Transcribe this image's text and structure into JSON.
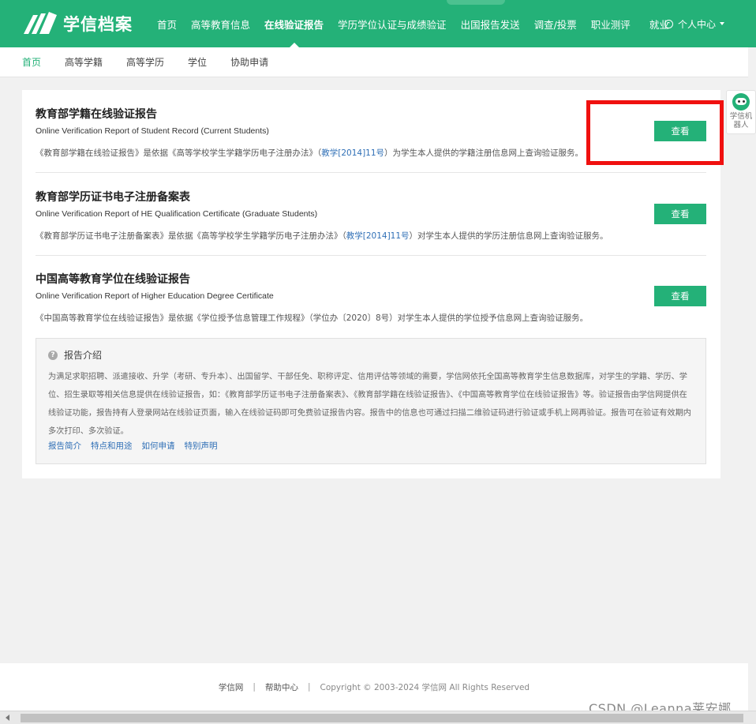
{
  "header": {
    "logo_text": "学信档案",
    "nav": [
      {
        "label": "首页",
        "active": false
      },
      {
        "label": "高等教育信息",
        "active": false
      },
      {
        "label": "在线验证报告",
        "active": true
      },
      {
        "label": "学历学位认证与成绩验证",
        "active": false
      },
      {
        "label": "出国报告发送",
        "active": false
      },
      {
        "label": "调查/投票",
        "active": false
      },
      {
        "label": "职业测评",
        "active": false
      },
      {
        "label": "就业",
        "active": false
      }
    ],
    "user_center": "个人中心"
  },
  "subnav": [
    {
      "label": "首页",
      "active": true
    },
    {
      "label": "高等学籍",
      "active": false
    },
    {
      "label": "高等学历",
      "active": false
    },
    {
      "label": "学位",
      "active": false
    },
    {
      "label": "协助申请",
      "active": false
    }
  ],
  "robot": {
    "label": "学信机器人"
  },
  "reports": [
    {
      "title": "教育部学籍在线验证报告",
      "en": "Online Verification Report of Student Record (Current Students)",
      "desc_pre": "《教育部学籍在线验证报告》是依据《高等学校学生学籍学历电子注册办法》（",
      "desc_link": "教学[2014]11号",
      "desc_post": "）为学生本人提供的学籍注册信息网上查询验证服务。",
      "button": "查看"
    },
    {
      "title": "教育部学历证书电子注册备案表",
      "en": "Online Verification Report of HE Qualification Certificate (Graduate Students)",
      "desc_pre": "《教育部学历证书电子注册备案表》是依据《高等学校学生学籍学历电子注册办法》（",
      "desc_link": "教学[2014]11号",
      "desc_post": "）对学生本人提供的学历注册信息网上查询验证服务。",
      "button": "查看"
    },
    {
      "title": "中国高等教育学位在线验证报告",
      "en": "Online Verification Report of Higher Education Degree Certificate",
      "desc_pre": "《中国高等教育学位在线验证报告》是依据《学位授予信息管理工作规程》（学位办〔2020〕8号）对学生本人提供的学位授予信息网上查询验证服务。",
      "desc_link": "",
      "desc_post": "",
      "button": "查看"
    }
  ],
  "intro": {
    "title": "报告介绍",
    "text": "为满足求职招聘、派遣接收、升学（考研、专升本）、出国留学、干部任免、职称评定、信用评估等领域的需要，学信网依托全国高等教育学生信息数据库，对学生的学籍、学历、学位、招生录取等相关信息提供在线验证报告，如：《教育部学历证书电子注册备案表》、《教育部学籍在线验证报告》、《中国高等教育学位在线验证报告》等。验证报告由学信网提供在线验证功能，报告持有人登录网站在线验证页面，输入在线验证码即可免费验证报告内容。报告中的信息也可通过扫描二维验证码进行验证或手机上网再验证。报告可在验证有效期内多次打印、多次验证。",
    "links": [
      "报告简介",
      "特点和用途",
      "如何申请",
      "特别声明"
    ]
  },
  "footer": {
    "site": "学信网",
    "help": "帮助中心",
    "copyright": "Copyright © 2003-2024 学信网 All Rights Reserved"
  },
  "watermark": "CSDN @Leanna莱安娜"
}
